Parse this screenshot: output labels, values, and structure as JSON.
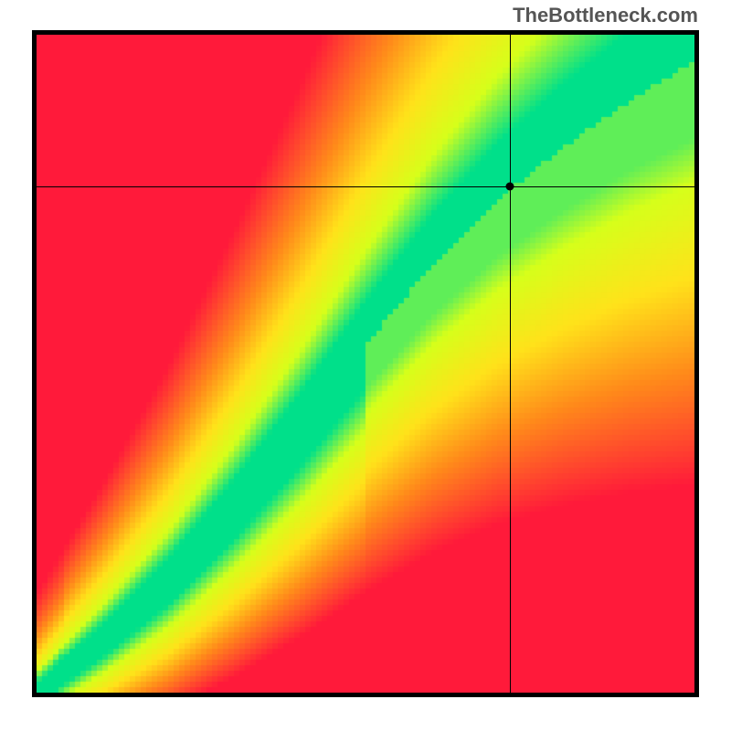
{
  "watermark": "TheBottleneck.com",
  "chart_data": {
    "type": "heatmap",
    "title": "",
    "xlabel": "",
    "ylabel": "",
    "xlim": [
      0,
      100
    ],
    "ylim": [
      0,
      100
    ],
    "crosshair": {
      "x": 72,
      "y": 77
    },
    "colorscale": [
      {
        "value": 0.0,
        "color": "#ff1a3a"
      },
      {
        "value": 0.35,
        "color": "#ff8a1a"
      },
      {
        "value": 0.6,
        "color": "#ffe21a"
      },
      {
        "value": 0.82,
        "color": "#d6ff1a"
      },
      {
        "value": 1.0,
        "color": "#00e08a"
      }
    ],
    "description": "Heatmap showing an optimal diagonal band (green) from bottom-left to top-right indicating balanced CPU/GPU pairing; values away from the ridge fade to yellow, orange, then red indicating bottleneck severity.",
    "ridge_points": [
      {
        "x": 0,
        "y": 0
      },
      {
        "x": 10,
        "y": 8
      },
      {
        "x": 20,
        "y": 17
      },
      {
        "x": 30,
        "y": 28
      },
      {
        "x": 40,
        "y": 40
      },
      {
        "x": 50,
        "y": 53
      },
      {
        "x": 60,
        "y": 65
      },
      {
        "x": 70,
        "y": 75
      },
      {
        "x": 80,
        "y": 83
      },
      {
        "x": 90,
        "y": 90
      },
      {
        "x": 100,
        "y": 96
      }
    ]
  }
}
